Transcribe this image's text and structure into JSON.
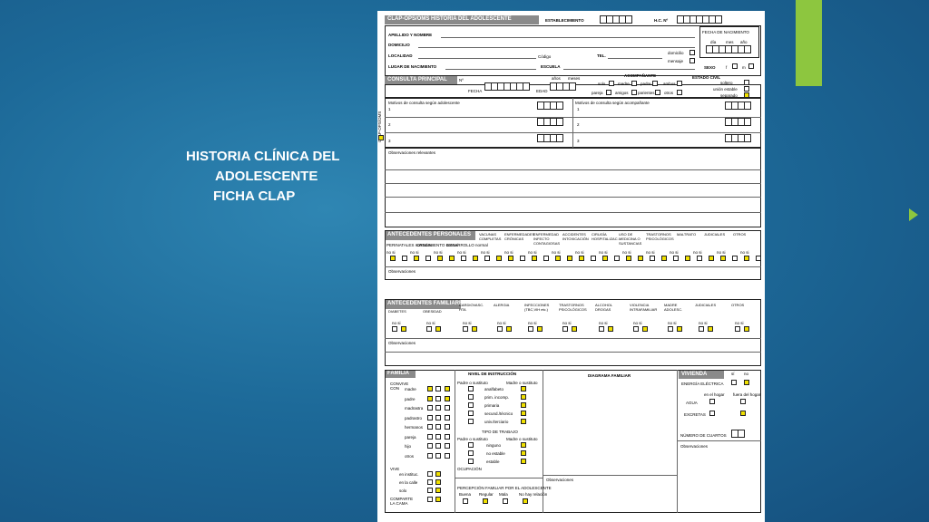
{
  "slide_title": [
    "HISTORIA CLÍNICA DEL",
    "ADOLESCENTE",
    "FICHA CLAP"
  ],
  "form": {
    "header": "CLAP-OPS/OMS   HISTORIA DEL ADOLESCENTE",
    "establecimiento": "ESTABLECIMIENTO",
    "hc": "H.C. Nº",
    "apellido": "APELLIDO Y NOMBRE",
    "domicilio": "DOMICILIO",
    "localidad": "LOCALIDAD",
    "codigo": "Código",
    "tel": "TEL.",
    "domicilio2": "domicilio",
    "mensaje": "mensaje",
    "lugar": "LUGAR DE NACIMIENTO",
    "escuela": "ESCUELA",
    "fecha_nac": "FECHA DE NACIMIENTO",
    "fecha_parts": [
      "día",
      "mes",
      "año"
    ],
    "sexo": "SEXO",
    "sexo_opts": [
      "f",
      "m"
    ],
    "consulta": "CONSULTA PRINCIPAL",
    "consulta_no": "Nº",
    "fecha": "FECHA",
    "edad": "EDAD",
    "anos_meses": [
      "años",
      "meses"
    ],
    "acompanante": "ACOMPAÑANTE",
    "acomp_opts": [
      "solo",
      "madre",
      "padre",
      "ambos",
      "pareja",
      "amigos",
      "parientes",
      "otros"
    ],
    "estado_civil": "ESTADO CIVIL",
    "civil_opts": [
      "soltero",
      "unión estable",
      "separado"
    ],
    "motivos_adol": "Motivos de consulta según adolescente",
    "motivos_acomp": "Motivos de consulta según acompañante",
    "nums": [
      "1",
      "2",
      "3"
    ],
    "observaciones_rel": "Observaciones relevantes",
    "observaciones": "Observaciones",
    "ant_personales": "ANTECEDENTES PERSONALES",
    "ap_cols": [
      "VACUNAS COMPLETAS",
      "ENFERMEDADES CRÓNICAS",
      "ENFERMEDAD INFECTO CONTAGIOSAS",
      "ACCIDENTES INTOXICACIÓN",
      "CIRUGÍA HOSPITALIZAC.",
      "USO DE MEDICINA O SUSTANCIAS",
      "TRASTORNOS PSICOLÓGICOS",
      "MALTRATO",
      "JUDICIALES",
      "OTROS"
    ],
    "ap_sub": [
      "PERINATALES normales",
      "CRECIMIENTO normal",
      "DESARROLLO normal"
    ],
    "ant_familiares": "ANTECEDENTES FAMILIARES",
    "af_cols": [
      "DIABETES",
      "OBESIDAD",
      "CARDIOVASC. HTA",
      "ALERGIA",
      "INFECCIONES (TBC,VIH etc.)",
      "TRASTORNOS PSICOLÓGICOS",
      "ALCOHOL DROGAS",
      "VIOLENCIA INTRAFAMILIAR",
      "MADRE ADOLESC.",
      "JUDICIALES",
      "OTROS"
    ],
    "no_si": "no   si",
    "familia": "FAMILIA",
    "convive": "CONVIVE CON",
    "convive_rows": [
      "madre",
      "padre",
      "madrastra",
      "padrastro",
      "hermanos",
      "pareja",
      "hijo",
      "otros"
    ],
    "nivel_instruccion": "NIVEL DE INSTRUCCIÓN",
    "padre_madre": [
      "Padre o sustituto",
      "Madre o sustituto"
    ],
    "instr_rows": [
      "analfabeto",
      "prim. incomp.",
      "primaria",
      "secund./técnico",
      "univ./terciario"
    ],
    "tipo_trabajo": "TIPO DE TRABAJO",
    "trab_rows": [
      "ninguno",
      "no estable",
      "estable"
    ],
    "diagrama": "DIAGRAMA FAMILIAR",
    "vivienda": "VIVIENDA",
    "viv_si_no": [
      "sí",
      "no"
    ],
    "energia": "ENERGÍA ELÉCTRICA",
    "en_hogar": [
      "en el hogar",
      "fuera del hogar"
    ],
    "agua": "AGUA",
    "excretas": "EXCRETAS",
    "num_cuartos": "NÚMERO DE CUARTOS",
    "vive": "VIVE",
    "vive_rows": [
      "en instituc.",
      "en la calle",
      "solo"
    ],
    "comparte": "COMPARTE LA CAMA",
    "ocupacion": "OCUPACIÓN",
    "percepcion": "PERCEPCIÓN FAMILIAR POR EL ADOLESCENTE",
    "percep_opts": [
      "Buena",
      "Regular",
      "Mala",
      "No hay relación"
    ],
    "side_code": "CLAP-OPS/OMS"
  }
}
